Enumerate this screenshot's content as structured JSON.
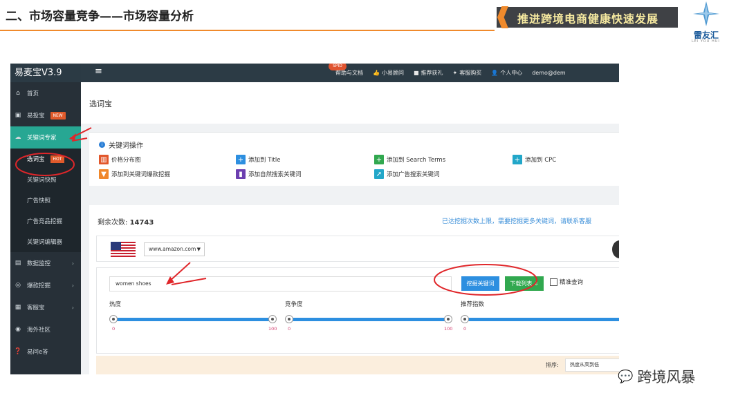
{
  "slide": {
    "title": "二、市场容量竞争——市场容量分析",
    "banner_text": "推进跨境电商健康快速发展",
    "logo_text": "雷友汇",
    "logo_sub": "LEI YOU HUI",
    "watermark": "跨境风暴"
  },
  "app": {
    "brand": "易麦宝V3.9",
    "menu_icon": "≡",
    "top_badge": "SPID",
    "top_links": [
      "帮助与文档",
      "小易顾问",
      "推荐获礼",
      "客服购买",
      "个人中心",
      "demo@dem"
    ],
    "sidebar": {
      "items": [
        {
          "label": "首页",
          "icon": "home-icon"
        },
        {
          "label": "易投宝",
          "icon": "briefcase-icon",
          "tag": "NEW"
        },
        {
          "label": "关键词专家",
          "icon": "cloud-icon"
        },
        {
          "label": "数据监控",
          "icon": "monitor-icon"
        },
        {
          "label": "爆款挖掘",
          "icon": "target-icon"
        },
        {
          "label": "客服宝",
          "icon": "box-icon"
        },
        {
          "label": "海外社区",
          "icon": "globe-icon"
        },
        {
          "label": "易问e答",
          "icon": "question-icon"
        }
      ],
      "sub_items": [
        {
          "label": "选词宝",
          "tag": "HOT"
        },
        {
          "label": "关键词快照"
        },
        {
          "label": "广告快照"
        },
        {
          "label": "广告竞品挖掘"
        },
        {
          "label": "关键词编辑器"
        }
      ]
    },
    "page_title": "选词宝",
    "ops": {
      "heading": "关键词操作",
      "items": [
        "价格分布图",
        "添加到 Title",
        "添加到 Search Terms",
        "添加到 CPC",
        "添加到关键词爆款挖掘",
        "添加自然搜索关键词",
        "添加广告搜索关键词"
      ]
    },
    "panel": {
      "remain_label": "剩余次数:",
      "remain_value": "14743",
      "notice": "已达挖掘次数上限，需要挖掘更多关键词，请联系客服",
      "site": "www.amazon.com",
      "keyword": "women shoes",
      "dig_button": "挖掘关键词",
      "download_button": "下载列表",
      "exact_label": "精准查询",
      "sliders": [
        {
          "label": "热度",
          "min": "0",
          "max": "100"
        },
        {
          "label": "竞争度",
          "min": "0",
          "max": "100"
        },
        {
          "label": "推荐指数",
          "min": "0",
          "max": ""
        }
      ],
      "sort_label": "排序:",
      "sort_value": "热度从高到低"
    }
  },
  "colors": {
    "accent_orange": "#f08a2c",
    "sidebar_active": "#27a793",
    "annotation_red": "#e0262a",
    "btn_blue": "#2d8fe0",
    "btn_green": "#31a84f"
  }
}
